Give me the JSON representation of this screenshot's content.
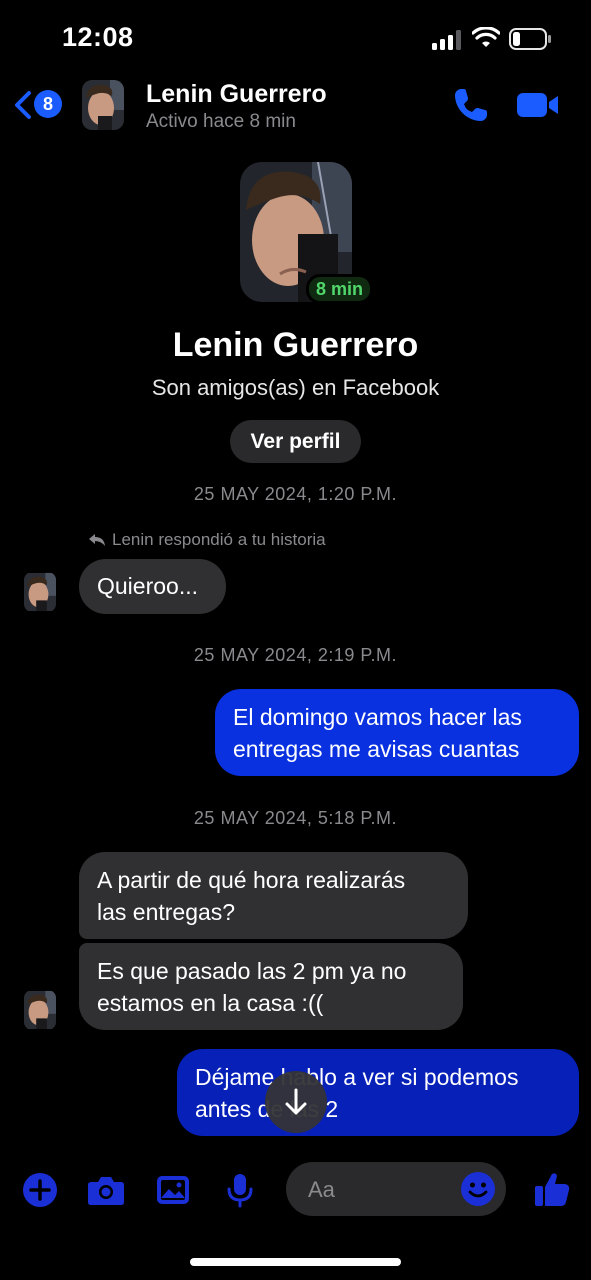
{
  "status_bar": {
    "time": "12:08"
  },
  "header": {
    "back_count": "8",
    "contact_name": "Lenin Guerrero",
    "active_status": "Activo hace 8 min"
  },
  "profile": {
    "active_badge": "8 min",
    "name": "Lenin Guerrero",
    "subtitle": "Son amigos(as) en Facebook",
    "view_profile_label": "Ver perfil"
  },
  "conversation": {
    "timestamps": [
      "25 MAY 2024, 1:20 P.M.",
      "25 MAY 2024, 2:19 P.M.",
      "25 MAY 2024, 5:18 P.M."
    ],
    "reply_note": "Lenin respondió a tu historia",
    "messages": [
      {
        "direction": "in",
        "lines": [
          "Quieroo..."
        ]
      },
      {
        "direction": "out",
        "lines": [
          "El domingo vamos hacer las",
          "entregas  me avisas cuantas"
        ]
      },
      {
        "direction": "in",
        "lines": [
          "A partir de qué hora realizarás",
          "las entregas?"
        ]
      },
      {
        "direction": "in",
        "lines": [
          "Es que pasado las 2 pm ya no",
          "estamos en la casa :(("
        ]
      },
      {
        "direction": "out",
        "lines": [
          "Déjame hablo a ver si podemos",
          "antes de las 2"
        ]
      }
    ]
  },
  "composer": {
    "placeholder": "Aa",
    "icons": [
      "plus-icon",
      "camera-icon",
      "gallery-icon",
      "microphone-icon",
      "emoji-icon",
      "thumbs-up-icon"
    ]
  },
  "colors": {
    "accent": "#1a5cff",
    "outgoing_bubble": "#0a31e0",
    "incoming_bubble": "#303032",
    "active_green": "#51d66b",
    "background": "#000000"
  }
}
